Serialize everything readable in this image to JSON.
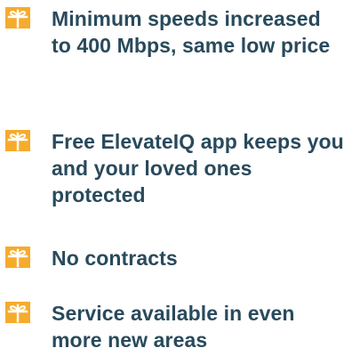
{
  "features": {
    "items": [
      {
        "icon": "gift-icon",
        "text": "Minimum speeds increased to 400 Mbps, same low price"
      },
      {
        "icon": "gift-icon",
        "text": "Free ElevateIQ app keeps you and your loved ones protected"
      },
      {
        "icon": "gift-icon",
        "text": "No contracts"
      },
      {
        "icon": "gift-icon",
        "text": "Service available in even more new areas"
      }
    ]
  },
  "colors": {
    "text": "#294a5c",
    "icon": "#f6ab2c"
  }
}
